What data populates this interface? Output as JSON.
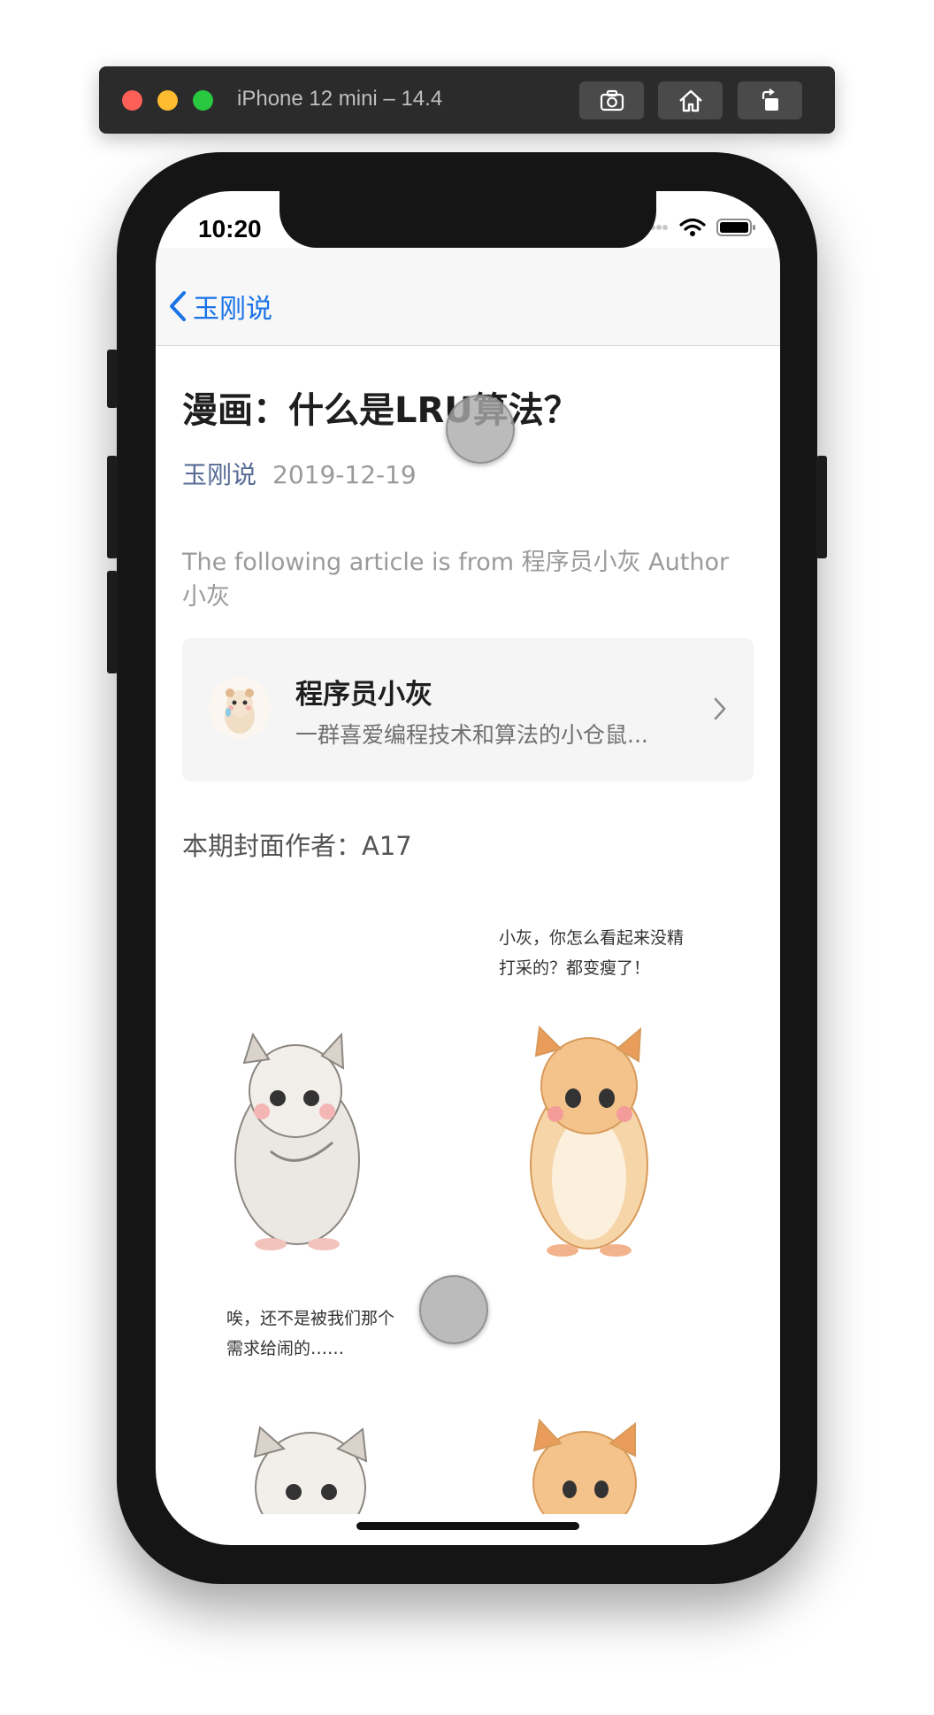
{
  "simulator": {
    "title": "iPhone 12 mini – 14.4",
    "buttons": [
      "screenshot-icon",
      "home-icon",
      "rotate-icon"
    ]
  },
  "status_bar": {
    "time": "10:20"
  },
  "nav": {
    "back_label": "玉刚说"
  },
  "article": {
    "title": "漫画：什么是LRU算法？",
    "author": "玉刚说",
    "date": "2019-12-19",
    "source_note": "The following article is from 程序员小灰 Author 小灰",
    "profile": {
      "name": "程序员小灰",
      "description": "一群喜爱编程技术和算法的小仓鼠..."
    },
    "cover_credit": "本期封面作者：A17"
  },
  "comic": {
    "speech_1_line1": "小灰，你怎么看起来没精",
    "speech_1_line2": "打采的？都变瘦了！",
    "speech_2_line1": "唉，还不是被我们那个",
    "speech_2_line2": "需求给闹的……"
  },
  "colors": {
    "link": "#1a73e8",
    "author": "#576b95",
    "muted": "#9a9a9a"
  }
}
